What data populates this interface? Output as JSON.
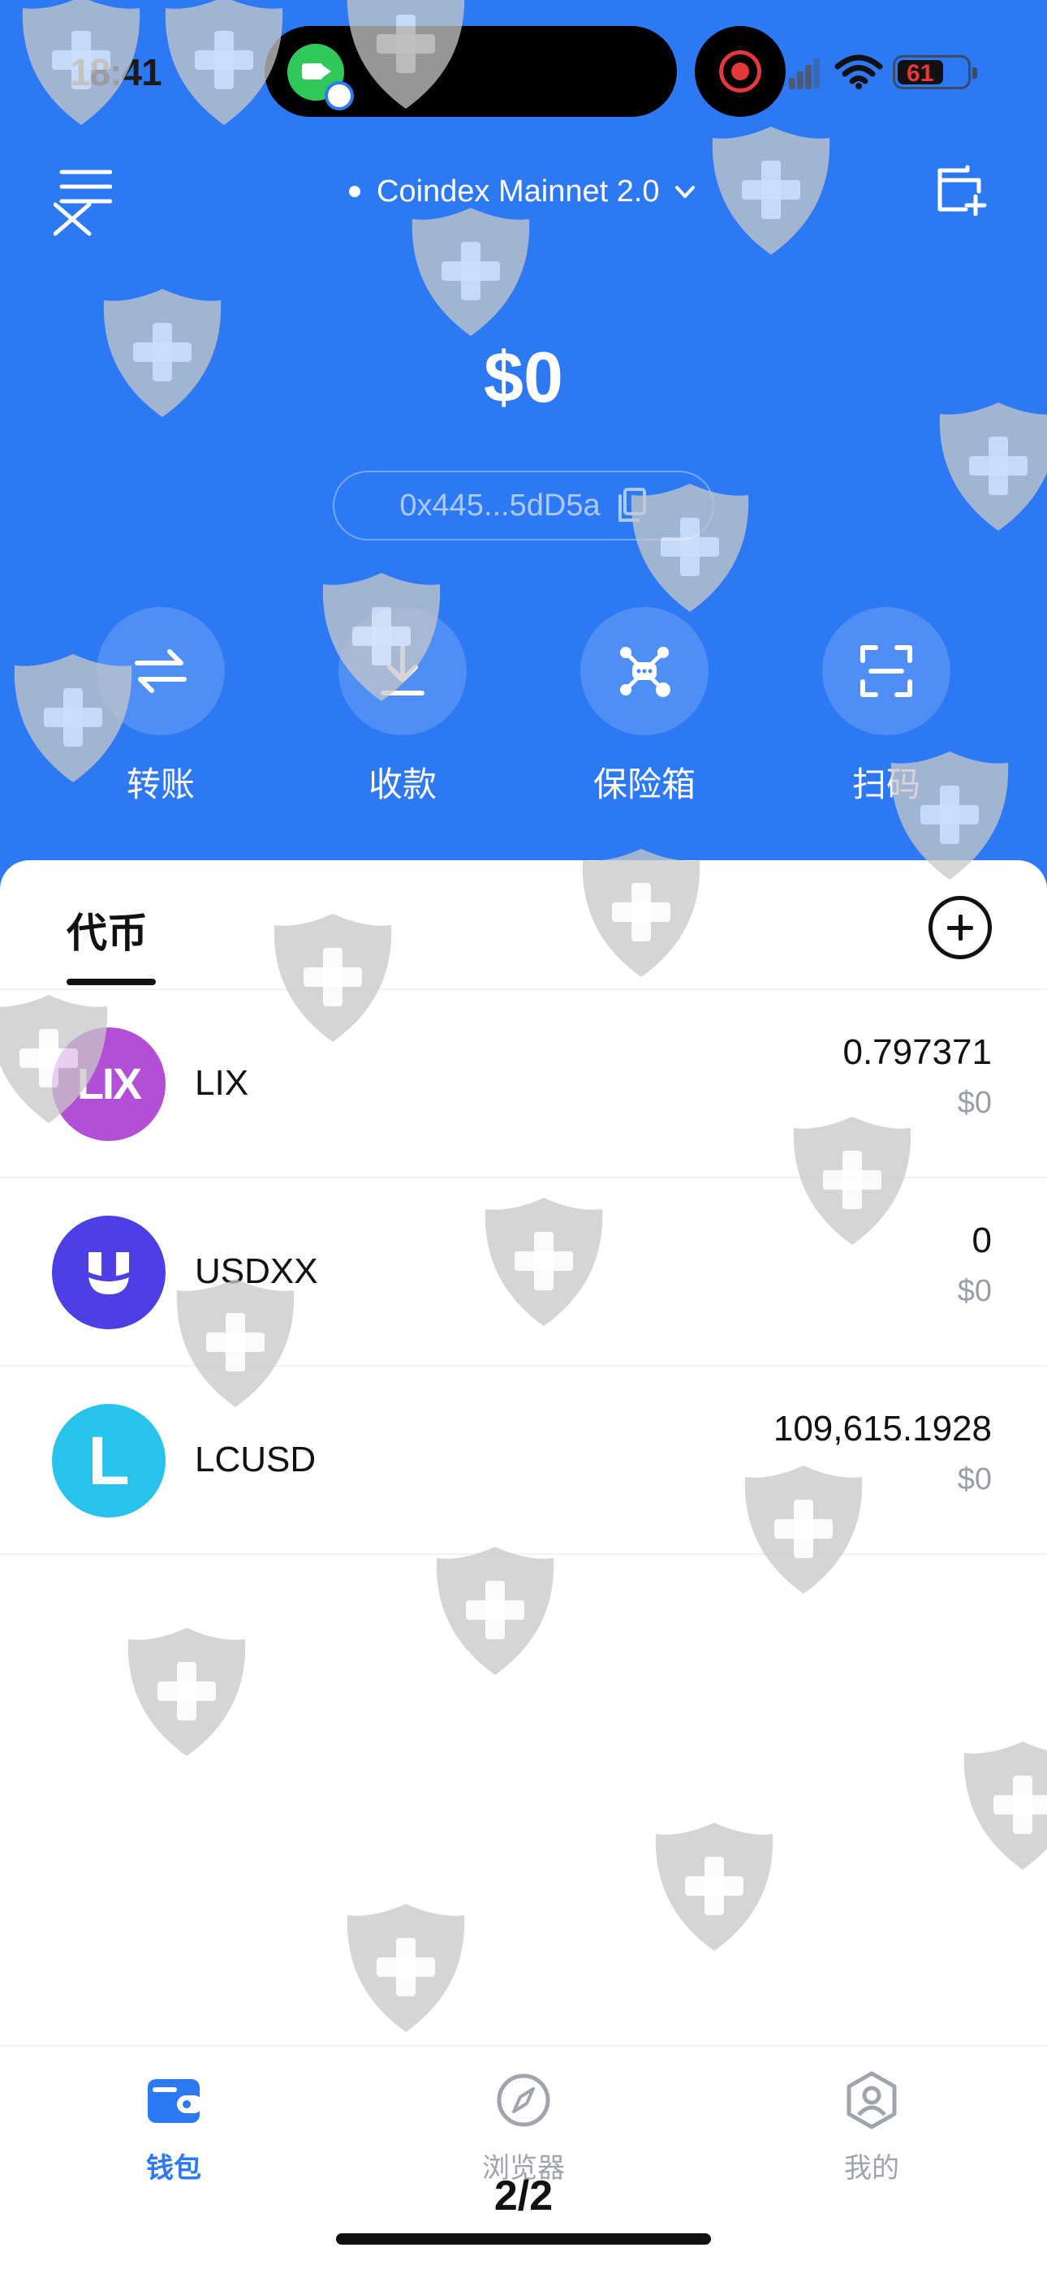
{
  "status_bar": {
    "time": "18:41",
    "battery": "61",
    "icons": [
      "facetime-icon",
      "screen-record-icon",
      "signal-icon",
      "wifi-icon",
      "battery-icon"
    ]
  },
  "header": {
    "network": "Coindex Mainnet 2.0",
    "icons": [
      "menu-close-icon",
      "chevron-down-icon",
      "add-wallet-icon"
    ]
  },
  "wallet": {
    "balance": "$0",
    "address": "0x445...5dD5a"
  },
  "actions": [
    {
      "label": "转账",
      "icon": "transfer-icon"
    },
    {
      "label": "收款",
      "icon": "receive-icon"
    },
    {
      "label": "保险箱",
      "icon": "safe-icon"
    },
    {
      "label": "扫码",
      "icon": "scan-icon"
    }
  ],
  "tokens_section": {
    "tab_label": "代币",
    "add_icon": "add-token-icon"
  },
  "tokens": [
    {
      "symbol": "LIX",
      "logo_text": "LIX",
      "amount": "0.797371",
      "fiat": "$0",
      "color": "#b24fd6"
    },
    {
      "symbol": "USDXX",
      "logo_text": "",
      "amount": "0",
      "fiat": "$0",
      "color": "#4d3fe6"
    },
    {
      "symbol": "LCUSD",
      "logo_text": "L",
      "amount": "109,615.1928",
      "fiat": "$0",
      "color": "#27c3ec"
    }
  ],
  "bottom_nav": [
    {
      "label": "钱包",
      "icon": "wallet-icon",
      "active": true
    },
    {
      "label": "浏览器",
      "icon": "compass-icon",
      "active": false
    },
    {
      "label": "我的",
      "icon": "profile-icon",
      "active": false
    }
  ],
  "page_indicator": "2/2",
  "colors": {
    "primary": "#2d79f3",
    "text": "#111111",
    "muted": "#9a9ea8",
    "watermark": "#c8c8c8"
  }
}
